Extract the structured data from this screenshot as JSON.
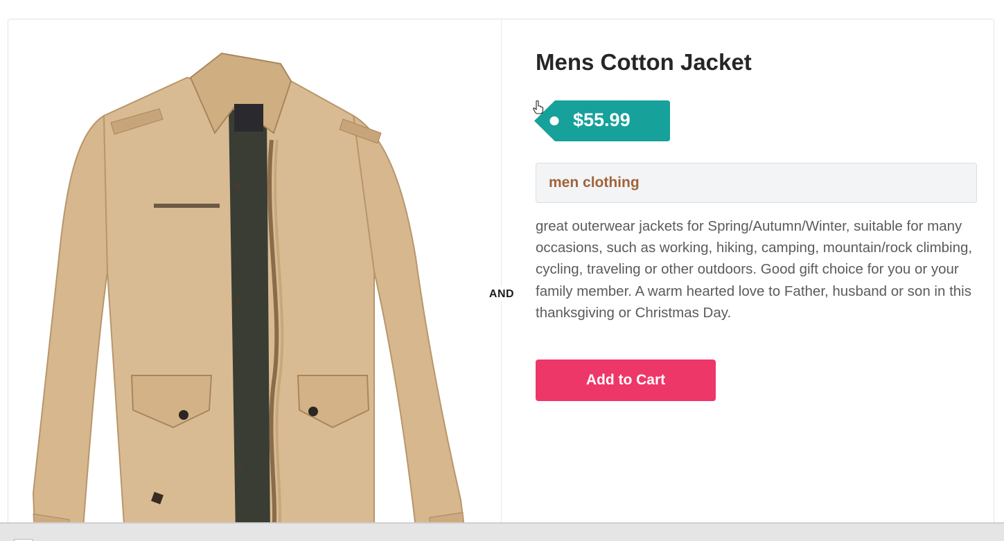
{
  "product": {
    "title": "Mens Cotton Jacket",
    "price": "$55.99",
    "category": "men clothing",
    "description": "great outerwear jackets for Spring/Autumn/Winter, suitable for many occasions, such as working, hiking, camping, mountain/rock climbing, cycling, traveling or other outdoors. Good gift choice for you or your family member. A warm hearted love to Father, husband or son in this thanksgiving or Christmas Day.",
    "add_to_cart_label": "Add to Cart"
  },
  "divider": {
    "label": "AND"
  },
  "colors": {
    "price_tag": "#16a19a",
    "category_text": "#a0633a",
    "add_to_cart": "#ee3769",
    "title": "#262626"
  },
  "icons": {
    "cursor": "hand-pointer-icon",
    "tag_hole": "tag-hole-icon"
  }
}
